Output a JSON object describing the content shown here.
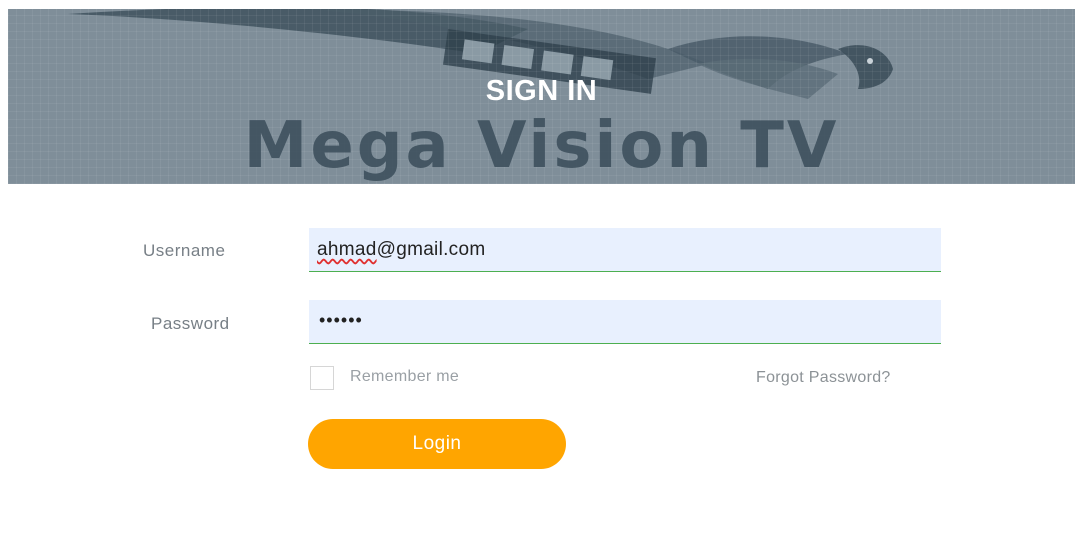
{
  "banner": {
    "title": "SIGN IN",
    "brand": "Mega Vision TV"
  },
  "form": {
    "username_label": "Username",
    "username_value_underlined": "ahmad",
    "username_value_rest": "@gmail.com",
    "password_label": "Password",
    "password_value": "••••••",
    "remember_label": "Remember me",
    "remember_checked": false,
    "forgot_label": "Forgot Password?",
    "login_label": "Login"
  },
  "colors": {
    "banner_bg": "#7f8e99",
    "field_bg": "#e8f0fe",
    "field_underline": "#4caf50",
    "login_button": "#ffa500"
  },
  "icons": {
    "banner_art": "film-strip-eagle-logo"
  }
}
